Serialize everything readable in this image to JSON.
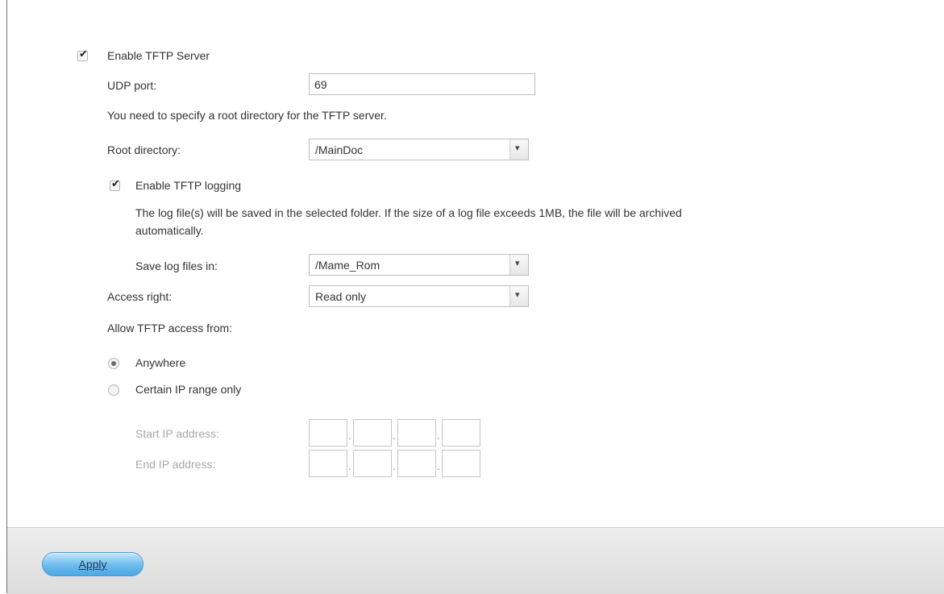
{
  "tftp": {
    "enable_label": "Enable TFTP Server",
    "enable_checked": true,
    "udp_port_label": "UDP port:",
    "udp_port_value": "69",
    "root_dir_note": "You need to specify a root directory for the TFTP server.",
    "root_dir_label": "Root directory:",
    "root_dir_value": "/MainDoc",
    "logging_label": "Enable TFTP logging",
    "logging_checked": true,
    "log_note_line1": "The log file(s) will be saved in the selected folder. If the size of a log file exceeds 1MB, the file will be archived",
    "log_note_line2": "automatically.",
    "save_log_label": "Save log files in:",
    "save_log_value": "/Mame_Rom",
    "access_right_label": "Access right:",
    "access_right_value": "Read only",
    "allow_from_label": "Allow TFTP access from:",
    "anywhere_label": "Anywhere",
    "anywhere_selected": true,
    "ip_range_label": "Certain IP range only",
    "ip_range_selected": false,
    "start_ip_label": "Start IP address:",
    "end_ip_label": "End IP address:",
    "start_ip_octets": [
      "",
      "",
      "",
      ""
    ],
    "end_ip_octets": [
      "",
      "",
      "",
      ""
    ]
  },
  "footer": {
    "apply_label": "Apply"
  },
  "icons": {
    "checkbox_mark": "checkmark-icon",
    "select_arrow": "chevron-down-icon"
  },
  "colors": {
    "apply_button": "#6cbbee",
    "footer_bg": "#e4e4e4",
    "disabled_text": "#a8a8a8"
  }
}
